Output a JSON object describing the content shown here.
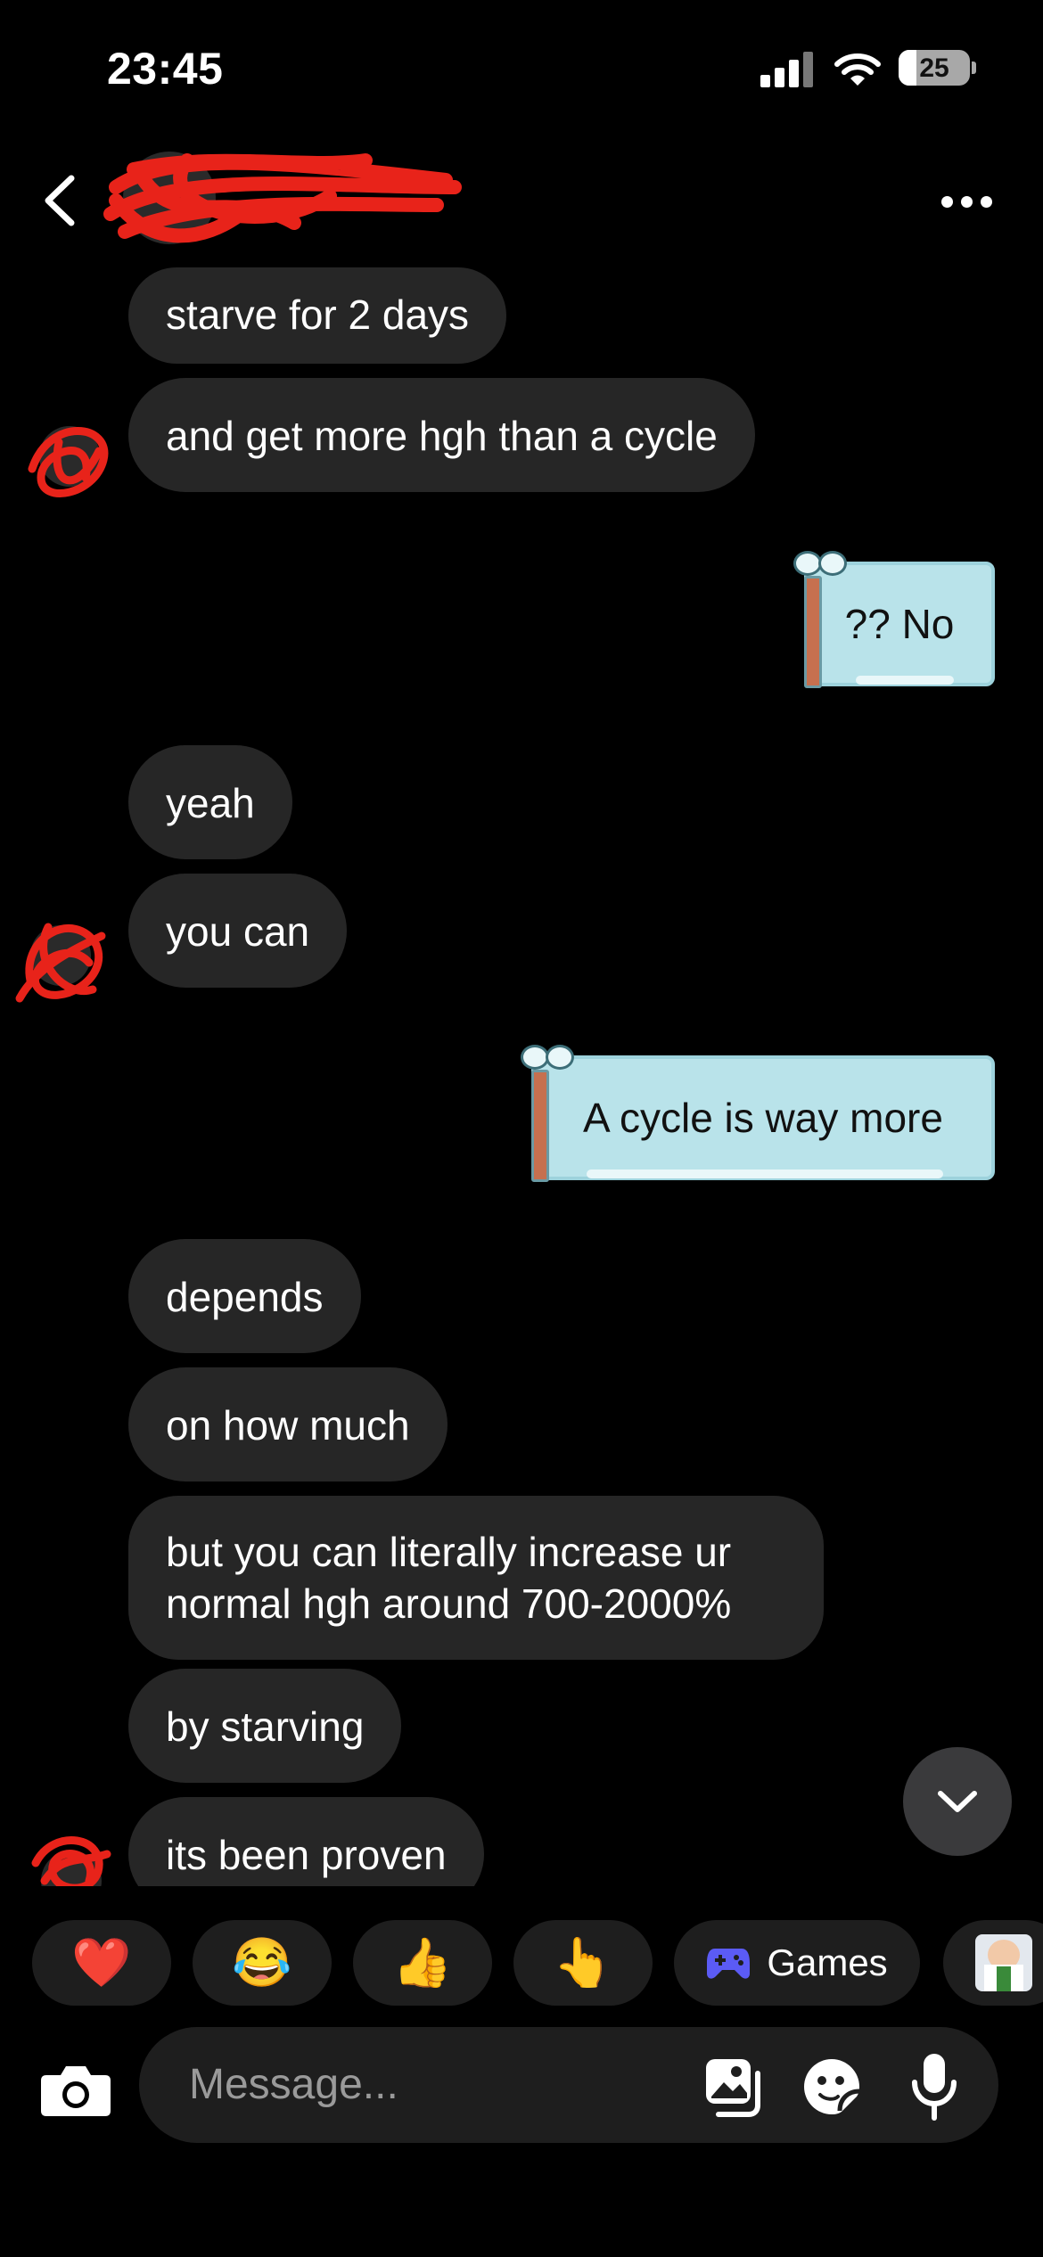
{
  "status_bar": {
    "time": "23:45",
    "battery": "25"
  },
  "header": {
    "back_icon": "chevron-left-icon",
    "more_icon": "ellipsis-icon"
  },
  "messages": [
    {
      "from": "them",
      "text": "starve for 2 days"
    },
    {
      "from": "them",
      "text": "and get more hgh than a cycle"
    },
    {
      "from": "me",
      "text": "?? No",
      "style": "note"
    },
    {
      "from": "them",
      "text": "yeah"
    },
    {
      "from": "them",
      "text": "you can"
    },
    {
      "from": "me",
      "text": "A cycle is way more",
      "style": "note"
    },
    {
      "from": "them",
      "text": "depends"
    },
    {
      "from": "them",
      "text": "on how much"
    },
    {
      "from": "them",
      "text": "but you can literally increase ur normal hgh around 700-2000%"
    },
    {
      "from": "them",
      "text": "by starving"
    },
    {
      "from": "them",
      "text": "its been proven"
    }
  ],
  "quick_reactions": [
    {
      "emoji": "❤️",
      "name": "heart"
    },
    {
      "emoji": "😂",
      "name": "tears-of-joy"
    },
    {
      "emoji": "👍",
      "name": "thumbs-up"
    },
    {
      "emoji": "👆",
      "name": "pointing-up"
    },
    {
      "label": "Games",
      "icon": "gamepad-icon"
    }
  ],
  "composer": {
    "placeholder": "Message..."
  },
  "colors": {
    "background": "#000000",
    "bubble": "#262626",
    "note": "#b9e3ea",
    "redaction": "#e8231a",
    "games_icon": "#5b5bf5"
  }
}
